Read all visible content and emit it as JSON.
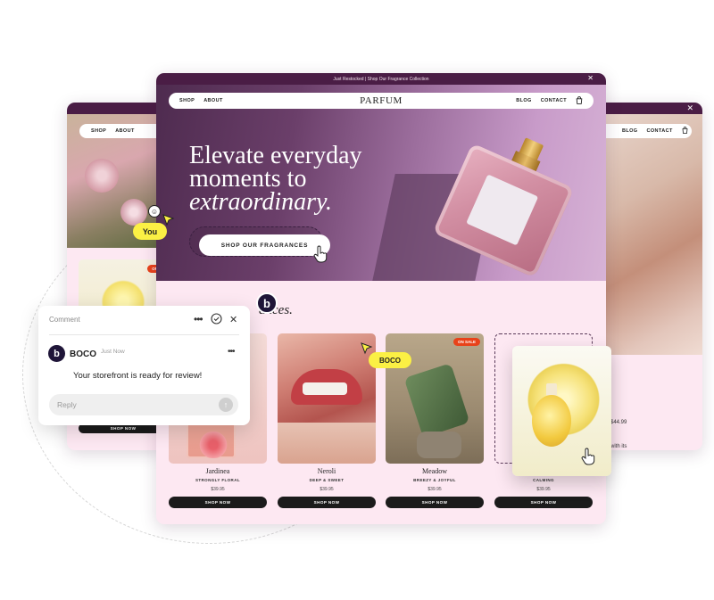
{
  "announcement": "Just Restocked | Shop Our Fragrance Collection",
  "nav": {
    "shop": "SHOP",
    "about": "ABOUT",
    "blog": "BLOG",
    "contact": "CONTACT"
  },
  "brand": "PARFUM",
  "hero": {
    "line1": "Elevate everyday",
    "line2": "moments to",
    "line3": "extraordinary.",
    "cta": "SHOP OUR FRAGRANCES"
  },
  "section_heading_partial": "ances.",
  "products": [
    {
      "name": "Jardinea",
      "desc": "STRONGLY FLORAL",
      "price": "$39.95",
      "button": "SHOP NOW"
    },
    {
      "name": "Neroli",
      "desc": "DEEP & SWEET",
      "price": "$39.95",
      "button": "SHOP NOW"
    },
    {
      "name": "Meadow",
      "desc": "BREEZY & JOYFUL",
      "price": "$39.95",
      "button": "SHOP NOW",
      "badge": "ON SALE"
    },
    {
      "name": "",
      "desc": "CALMING",
      "price": "$39.95",
      "button": "SHOP NOW"
    }
  ],
  "left_window": {
    "badge": "ON",
    "button": "SHOP NOW"
  },
  "right_window": {
    "price": "$44.99",
    "snippet": "with its"
  },
  "comment": {
    "header": "Comment",
    "author": "BOCO",
    "time": "Just Now",
    "avatar_letter": "b",
    "message": "Your storefront is ready for review!",
    "reply_placeholder": "Reply"
  },
  "cursors": {
    "you": "You",
    "boco": "BOCO"
  },
  "colors": {
    "topbar": "#4a1d45",
    "pink_bg": "#fde8f2",
    "yellow": "#fbf044",
    "avatar": "#1f1538",
    "sale": "#e8421a"
  },
  "icons": [
    "close-icon",
    "cart-icon",
    "more-icon",
    "check-circle-icon",
    "send-icon",
    "cursor-arrow-icon",
    "hand-pointer-icon",
    "smiley-icon"
  ]
}
